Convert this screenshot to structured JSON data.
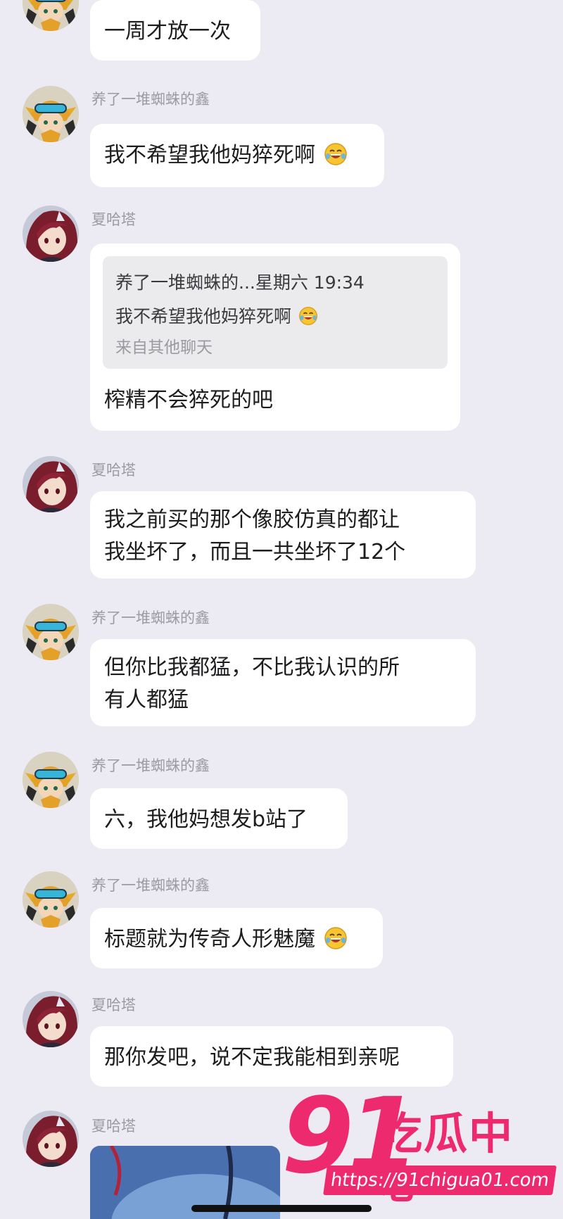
{
  "contacts": {
    "xin": "养了一堆蜘蛛的鑫",
    "xia": "夏哈塔"
  },
  "messages": [
    {
      "text": "一周才放一次"
    },
    {
      "text": "我不希望我他妈猝死啊",
      "emoji": "laughing-tears-emoji"
    },
    {
      "quote": {
        "header": "养了一堆蜘蛛的...星期六 19:34",
        "text": "我不希望我他妈猝死啊",
        "source": "来自其他聊天"
      },
      "text": "榨精不会猝死的吧"
    },
    {
      "line1": "我之前买的那个像胶仿真的都让",
      "line2": "我坐坏了，而且一共坐坏了12个"
    },
    {
      "line1": "但你比我都猛，不比我认识的所",
      "line2": "有人都猛"
    },
    {
      "text": "六，我他妈想发b站了"
    },
    {
      "text": "标题就为传奇人形魅魔",
      "emoji": "laughing-tears-emoji"
    },
    {
      "text": "那你发吧，说不定我能相到亲呢"
    }
  ],
  "watermark": {
    "number": "91",
    "brand": "吃瓜中心",
    "url": "https://91chigua01.com"
  },
  "colors": {
    "background": "#ecebf3",
    "bubble": "#ffffff",
    "watermark": "#ee2a6e"
  }
}
